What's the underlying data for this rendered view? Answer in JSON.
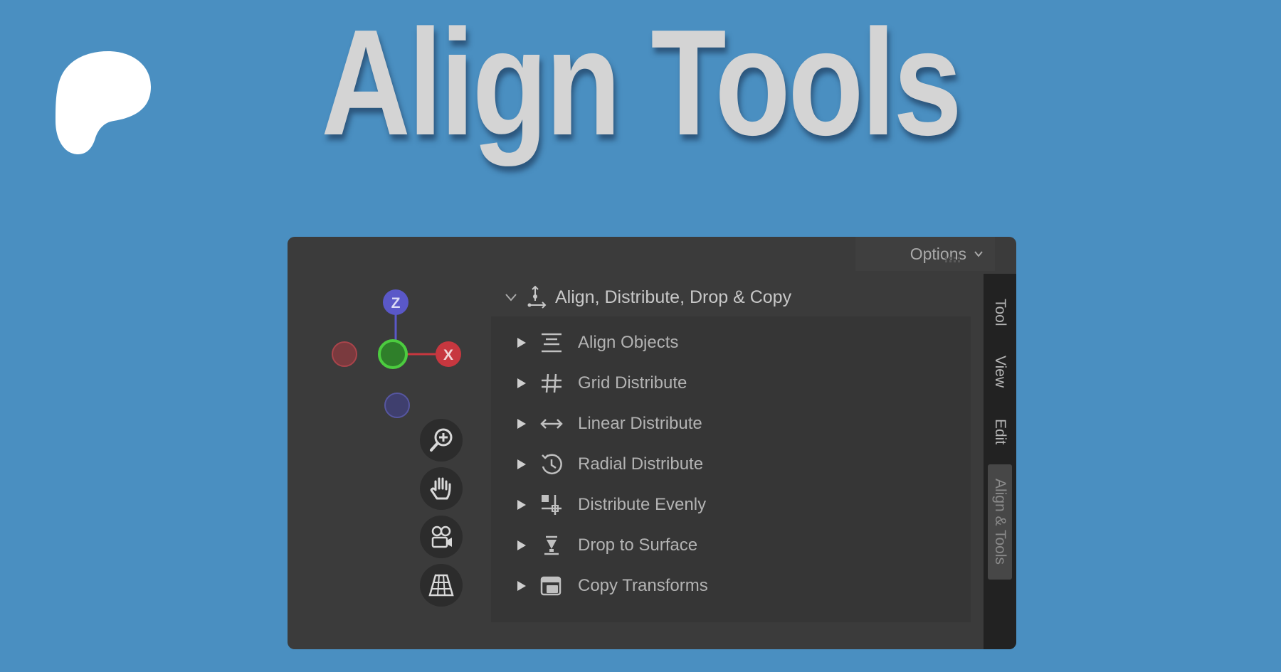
{
  "banner": {
    "title": "Align Tools"
  },
  "header": {
    "options_label": "Options"
  },
  "gizmo": {
    "z_label": "Z",
    "x_label": "X"
  },
  "panel": {
    "section_title": "Align, Distribute, Drop & Copy",
    "items": [
      {
        "label": "Align Objects",
        "icon": "align-objects-icon"
      },
      {
        "label": "Grid Distribute",
        "icon": "grid-distribute-icon"
      },
      {
        "label": "Linear Distribute",
        "icon": "linear-distribute-icon"
      },
      {
        "label": "Radial Distribute",
        "icon": "radial-distribute-icon"
      },
      {
        "label": "Distribute Evenly",
        "icon": "distribute-evenly-icon"
      },
      {
        "label": "Drop to Surface",
        "icon": "drop-to-surface-icon"
      },
      {
        "label": "Copy Transforms",
        "icon": "copy-transforms-icon"
      }
    ]
  },
  "sidebar": {
    "tabs": [
      {
        "label": "Tool",
        "active": false
      },
      {
        "label": "View",
        "active": false
      },
      {
        "label": "Edit",
        "active": false
      },
      {
        "label": "Align & Tools",
        "active": true
      }
    ]
  },
  "colors": {
    "background": "#4a8fc1",
    "panel": "#3b3b3b",
    "axis_x": "#c7373f",
    "axis_y": "#4ca341",
    "axis_z": "#5a58c8"
  }
}
